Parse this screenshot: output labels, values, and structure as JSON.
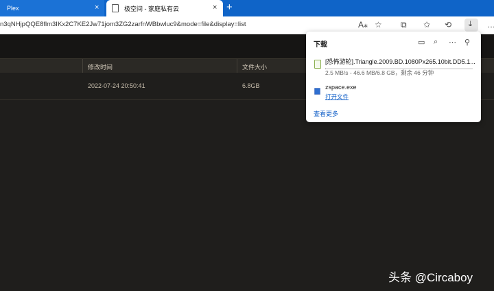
{
  "browser": {
    "tabs": [
      {
        "label": "Plex",
        "close": "×"
      },
      {
        "label": "极空间 - 家庭私有云",
        "close": "×"
      }
    ],
    "new_tab": "+",
    "url": "n3qNHjpQQE8flm3IKx2C7KE2Jw71jom3ZG2zarfnWBbwluc9&mode=file&display=list",
    "toolbar_icons": [
      "read-aloud-icon",
      "favorite-add-icon",
      "extensions-icon",
      "favorites-icon",
      "history-icon",
      "downloads-icon",
      "settings-more-icon"
    ]
  },
  "file_list": {
    "columns": [
      {
        "label": "修改时间"
      },
      {
        "label": "文件大小"
      }
    ],
    "rows": [
      {
        "modified": "2022-07-24 20:50:41",
        "size": "6.8GB"
      }
    ]
  },
  "downloads_panel": {
    "title": "下载",
    "header_icons": [
      "folder-icon",
      "search-icon",
      "more-icon",
      "pin-icon"
    ],
    "items": [
      {
        "name": "[恐怖游轮].Triangle.2009.BD.1080Px265.10bit.DD5.1...",
        "status": "2.5 MB/s - 46.6 MB/6.8 GB，剩余 46 分钟",
        "progress": 0.0067
      },
      {
        "name": "zspace.exe",
        "action": "打开文件"
      }
    ],
    "see_more": "查看更多"
  },
  "watermark": "头条 @Circaboy"
}
